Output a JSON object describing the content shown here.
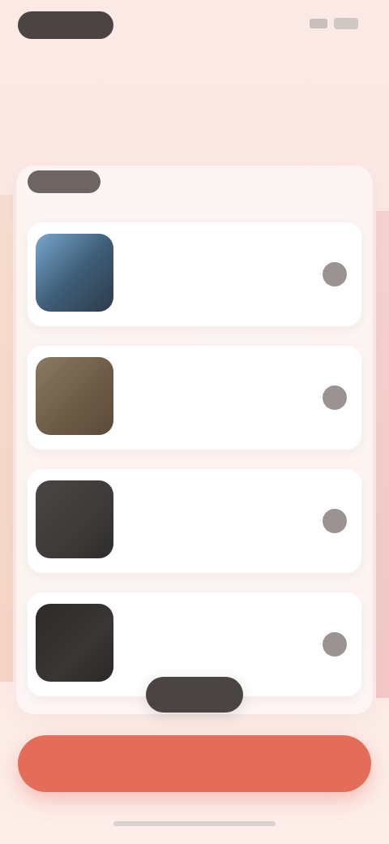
{
  "status": {
    "time": "",
    "signal_icon": "signal-icon",
    "battery_icon": "battery-icon"
  },
  "header": {
    "subtitle": "",
    "title": ""
  },
  "list": {
    "header_badge": "",
    "header_text": "",
    "items": [
      {
        "title": "",
        "desc_lines": [
          "",
          "",
          ""
        ]
      },
      {
        "title": "",
        "desc_lines": [
          "",
          "",
          ""
        ]
      },
      {
        "title": "",
        "desc_lines": [
          "",
          "",
          ""
        ]
      },
      {
        "title": "",
        "desc_lines": [
          "",
          "",
          ""
        ]
      }
    ]
  },
  "scroll_pill": {
    "label": ""
  },
  "primary_button": {
    "label": ""
  },
  "colors": {
    "primary": "#e46d5a",
    "dark": "#4a4442",
    "background": "#fce7e3"
  }
}
